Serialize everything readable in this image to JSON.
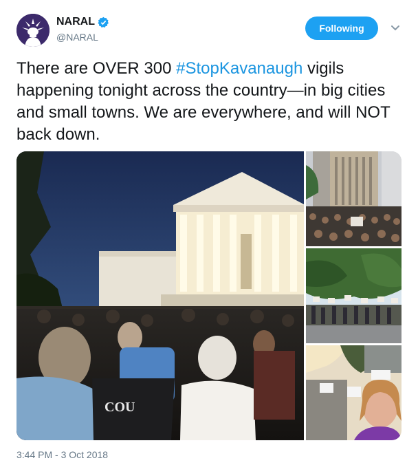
{
  "account": {
    "display_name": "NARAL",
    "handle": "@NARAL",
    "verified_icon": "verified-badge-icon",
    "avatar_icon": "statue-of-liberty-icon"
  },
  "follow_button": {
    "label": "Following"
  },
  "menu": {
    "icon": "chevron-down-icon"
  },
  "tweet": {
    "text_before": "There are OVER 300 ",
    "hashtag": "#StopKavanaugh",
    "text_after": " vigils happening tonight across the country—in big cities and small towns. We are everywhere, and will NOT back down."
  },
  "media": {
    "photo_main_caption": "Crowd at dusk in front of the Supreme Court building",
    "photo_2_caption": "Crowd in a city street surrounded by tall buildings",
    "photo_3_caption": "People holding signs along a road under trees",
    "photo_4_caption": "Selfie of a woman at a vigil along a street",
    "shirt_text": "COU"
  },
  "meta": {
    "timestamp": "3:44 PM - 3 Oct 2018"
  },
  "colors": {
    "brand_blue": "#1da1f2",
    "hashtag_blue": "#1b95e0",
    "secondary_text": "#657786",
    "avatar_purple": "#3c2a6b"
  }
}
